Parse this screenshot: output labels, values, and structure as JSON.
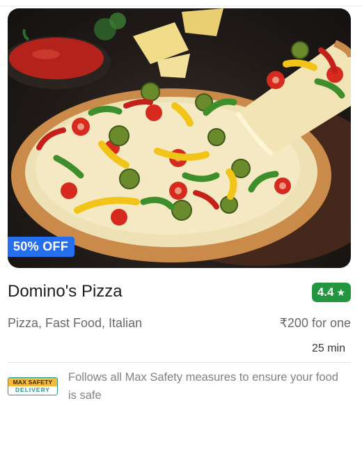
{
  "restaurant": {
    "name": "Domino's Pizza",
    "rating": "4.4",
    "rating_icon": "star-icon",
    "cuisines": "Pizza, Fast Food, Italian",
    "price": "₹200 for one",
    "delivery_time": "25 min",
    "offer": "50% OFF",
    "image_alt": "pizza-image"
  },
  "safety": {
    "logo_top": "MAX SAFETY",
    "logo_bottom": "DELIVERY",
    "message": "Follows all Max Safety measures to ensure your food is safe"
  },
  "colors": {
    "offer_badge": "#256fef",
    "rating_badge": "#24963f",
    "safety_teal": "#1f9a8b",
    "safety_yellow": "#f6b93b"
  }
}
